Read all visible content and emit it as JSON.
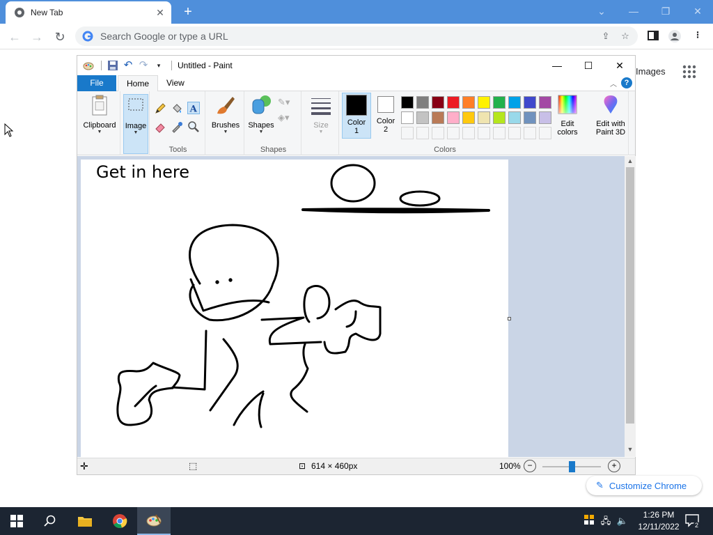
{
  "chrome": {
    "tab_title": "New Tab",
    "address_placeholder": "Search Google or type a URL",
    "images_link": "Images",
    "customize_label": "Customize Chrome"
  },
  "paint": {
    "window_title": "Untitled - Paint",
    "tabs": {
      "file": "File",
      "home": "Home",
      "view": "View"
    },
    "groups": {
      "clipboard": "Clipboard",
      "image": "Image",
      "tools": "Tools",
      "brushes": "Brushes",
      "shapes_button": "Shapes",
      "shapes_group": "Shapes",
      "size": "Size",
      "color1_line1": "Color",
      "color1_line2": "1",
      "color2_line1": "Color",
      "color2_line2": "2",
      "colors": "Colors",
      "edit_colors_line1": "Edit",
      "edit_colors_line2": "colors",
      "edit_paint3d_line1": "Edit with",
      "edit_paint3d_line2": "Paint 3D"
    },
    "palette_row1": [
      "#000000",
      "#7f7f7f",
      "#880015",
      "#ed1c24",
      "#ff7f27",
      "#fff200",
      "#22b14c",
      "#00a2e8",
      "#3f48cc",
      "#a349a4"
    ],
    "palette_row2": [
      "#ffffff",
      "#c3c3c3",
      "#b97a57",
      "#ffaec9",
      "#ffc90e",
      "#efe4b0",
      "#b5e61d",
      "#99d9ea",
      "#7092be",
      "#c8bfe7"
    ],
    "color1": "#000000",
    "color2": "#ffffff",
    "canvas_text": "Get in here",
    "status": {
      "dimensions": "614 × 460px",
      "zoom": "100%"
    }
  },
  "taskbar": {
    "time": "1:26 PM",
    "date": "12/11/2022",
    "notification_count": "2"
  }
}
